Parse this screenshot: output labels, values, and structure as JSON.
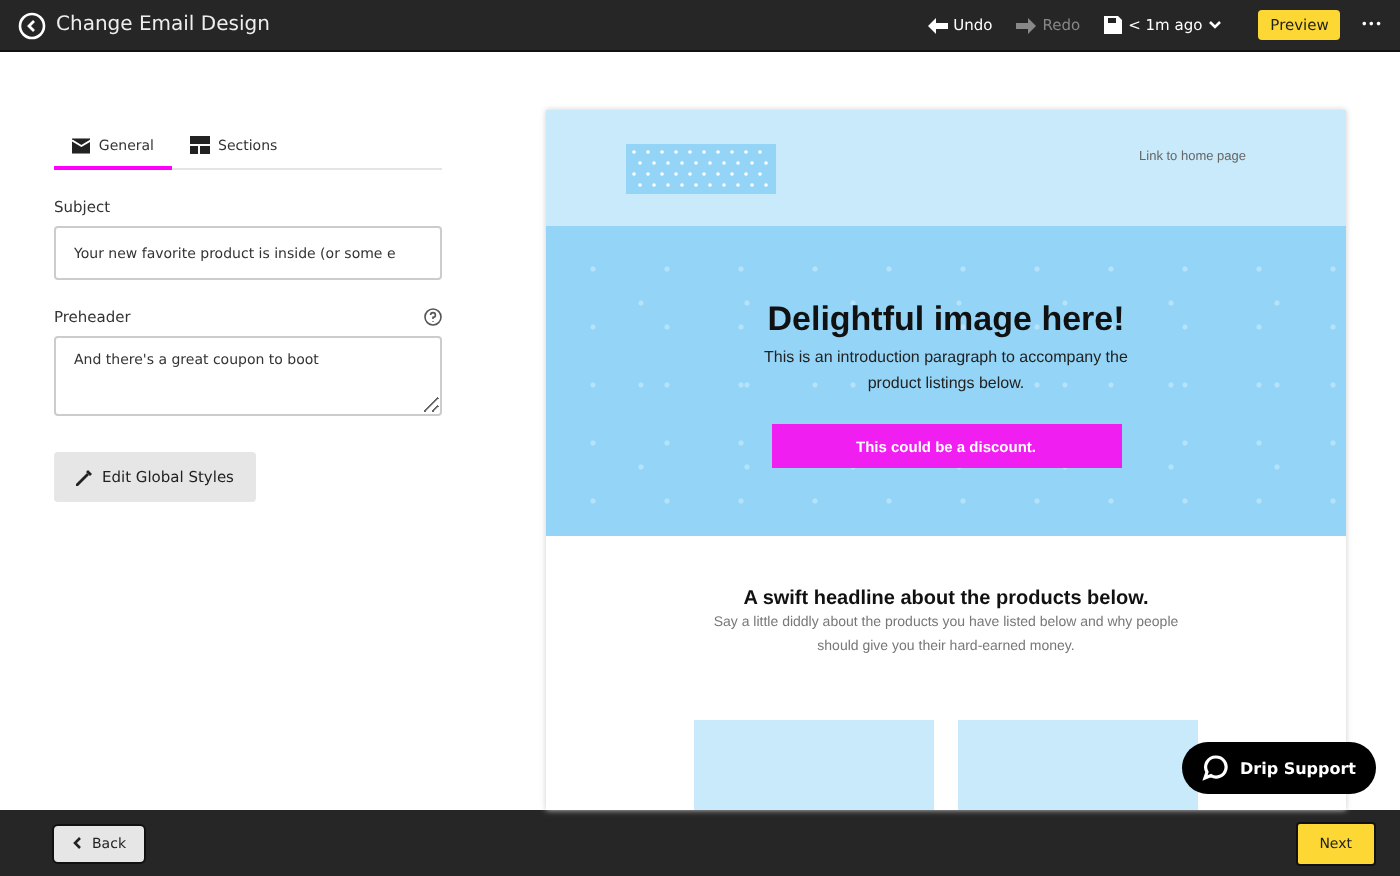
{
  "header": {
    "title": "Change Email Design",
    "undo": {
      "label": "Undo",
      "disabled": false
    },
    "redo": {
      "label": "Redo",
      "disabled": true
    },
    "saved": "< 1m ago",
    "preview": "Preview",
    "more": "•••"
  },
  "tabs": [
    {
      "label": "General",
      "selected": true
    },
    {
      "label": "Sections",
      "selected": false
    }
  ],
  "fields": [
    {
      "kind": "input",
      "label": "Subject",
      "value": "Your new favorite product is inside (or some e",
      "help": false
    },
    {
      "kind": "textarea",
      "label": "Preheader",
      "value": "And there's a great coupon to boot",
      "help": true
    }
  ],
  "edit_styles": "Edit Global Styles",
  "email": {
    "home_link": "Link to home page",
    "hero_title": "Delightful image here!",
    "hero_text": "This is an introduction paragraph to accompany the product listings below.",
    "cta": "This could be a discount.",
    "headline": "A swift headline about the products below.",
    "body": "Say a little diddly about the products you have listed below and why people should give you their hard-earned money."
  },
  "support": "Drip Support",
  "footer": {
    "back": "Back",
    "next": "Next"
  }
}
